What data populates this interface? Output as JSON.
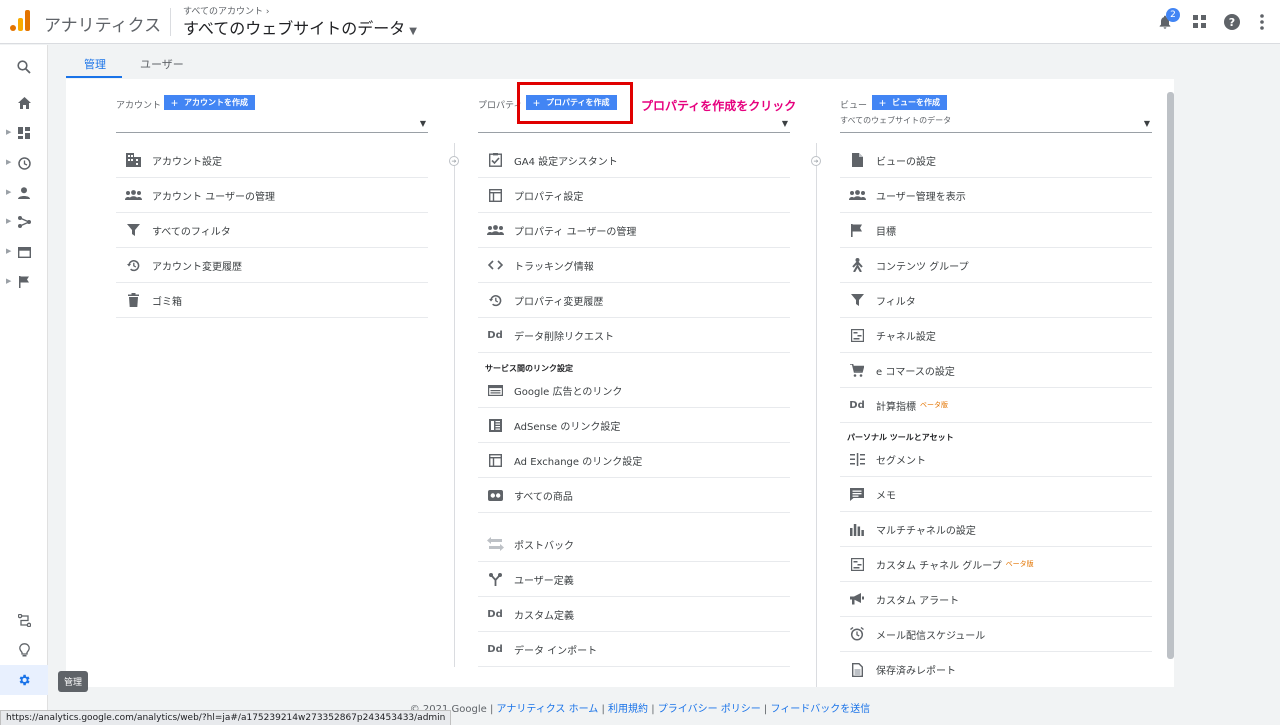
{
  "header": {
    "app_title": "アナリティクス",
    "breadcrumb": "すべてのアカウント ›",
    "view_name": "すべてのウェブサイトのデータ",
    "notification_count": "2"
  },
  "tabs": [
    {
      "label": "管理",
      "active": true
    },
    {
      "label": "ユーザー",
      "active": false
    }
  ],
  "account_col": {
    "title": "アカウント",
    "create_label": "アカウントを作成",
    "select_value": "",
    "items": [
      {
        "label": "アカウント設定",
        "icon": "building-icon"
      },
      {
        "label": "アカウント ユーザーの管理",
        "icon": "people-icon"
      },
      {
        "label": "すべてのフィルタ",
        "icon": "filter-icon"
      },
      {
        "label": "アカウント変更履歴",
        "icon": "history-icon"
      },
      {
        "label": "ゴミ箱",
        "icon": "trash-icon"
      }
    ]
  },
  "property_col": {
    "title": "プロパティ",
    "create_label": "プロパティを作成",
    "select_value": "",
    "items": [
      {
        "label": "GA4 設定アシスタント",
        "icon": "checklist-icon"
      },
      {
        "label": "プロパティ設定",
        "icon": "window-icon"
      },
      {
        "label": "プロパティ ユーザーの管理",
        "icon": "people-icon"
      },
      {
        "label": "トラッキング情報",
        "icon": "code-icon"
      },
      {
        "label": "プロパティ変更履歴",
        "icon": "history-icon"
      },
      {
        "label": "データ削除リクエスト",
        "icon": "dd-icon"
      }
    ],
    "section_title": "サービス間のリンク設定",
    "link_items": [
      {
        "label": "Google 広告とのリンク",
        "icon": "ads-icon"
      },
      {
        "label": "AdSense のリンク設定",
        "icon": "adsense-icon"
      },
      {
        "label": "Ad Exchange のリンク設定",
        "icon": "window-icon"
      },
      {
        "label": "すべての商品",
        "icon": "products-icon"
      }
    ],
    "other_items": [
      {
        "label": "ポストバック",
        "icon": "postback-icon"
      },
      {
        "label": "ユーザー定義",
        "icon": "fork-icon"
      },
      {
        "label": "カスタム定義",
        "icon": "dd-icon"
      },
      {
        "label": "データ インポート",
        "icon": "dd-icon"
      }
    ]
  },
  "view_col": {
    "title": "ビュー",
    "create_label": "ビューを作成",
    "select_value": "すべてのウェブサイトのデータ",
    "items": [
      {
        "label": "ビューの設定",
        "icon": "document-icon"
      },
      {
        "label": "ユーザー管理を表示",
        "icon": "people-icon"
      },
      {
        "label": "目標",
        "icon": "flag-icon"
      },
      {
        "label": "コンテンツ グループ",
        "icon": "person-walk-icon"
      },
      {
        "label": "フィルタ",
        "icon": "filter-icon"
      },
      {
        "label": "チャネル設定",
        "icon": "channel-icon"
      },
      {
        "label": "e コマースの設定",
        "icon": "cart-icon"
      },
      {
        "label": "計算指標",
        "icon": "dd-icon",
        "beta": "ベータ版"
      }
    ],
    "section_title": "パーソナル ツールとアセット",
    "personal_items": [
      {
        "label": "セグメント",
        "icon": "segment-icon"
      },
      {
        "label": "メモ",
        "icon": "comment-icon"
      },
      {
        "label": "マルチチャネルの設定",
        "icon": "bar-chart-icon"
      },
      {
        "label": "カスタム チャネル グループ",
        "icon": "channel-icon",
        "beta": "ベータ版"
      },
      {
        "label": "カスタム アラート",
        "icon": "megaphone-icon"
      },
      {
        "label": "メール配信スケジュール",
        "icon": "alarm-icon"
      },
      {
        "label": "保存済みレポート",
        "icon": "saved-report-icon"
      }
    ]
  },
  "annotation": "プロパティを作成をクリック",
  "footer": {
    "copyright": "© 2021 Google",
    "links": [
      "アナリティクス ホーム",
      "利用規約",
      "プライバシー ポリシー",
      "フィードバックを送信"
    ]
  },
  "tooltip": "管理",
  "status_url": "https://analytics.google.com/analytics/web/?hl=ja#/a175239214w273352867p243453433/admin"
}
